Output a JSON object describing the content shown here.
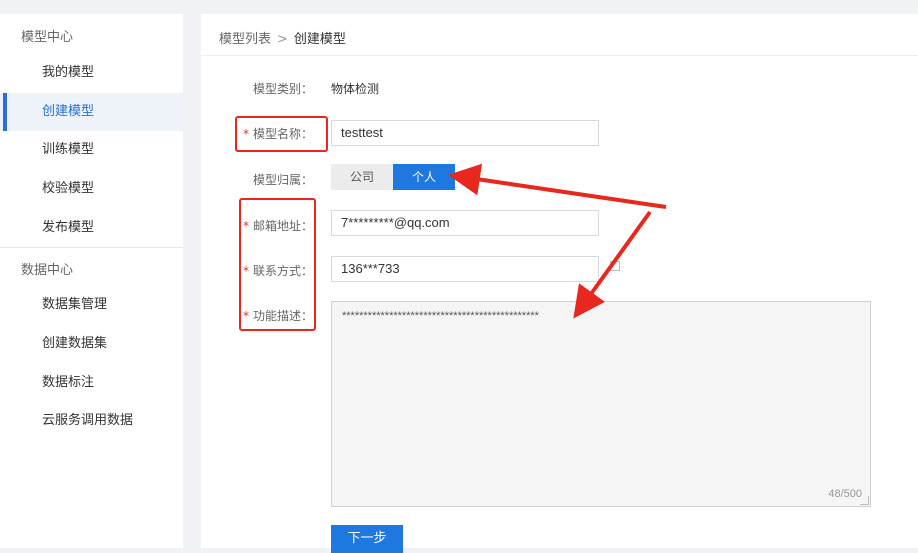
{
  "sidebar": {
    "groups": [
      {
        "title": "模型中心",
        "items": [
          "我的模型",
          "创建模型",
          "训练模型",
          "校验模型",
          "发布模型"
        ]
      },
      {
        "title": "数据中心",
        "items": [
          "数据集管理",
          "创建数据集",
          "数据标注",
          "云服务调用数据"
        ]
      }
    ],
    "active_item": "创建模型"
  },
  "breadcrumb": {
    "parent": "模型列表",
    "separator": ">",
    "current": "创建模型"
  },
  "form": {
    "model_type": {
      "label": "模型类别：",
      "value": "物体检测"
    },
    "model_name": {
      "label": "模型名称：",
      "value": "testtest",
      "required": true
    },
    "ownership": {
      "label": "模型归属：",
      "options": [
        "公司",
        "个人"
      ],
      "selected": "个人"
    },
    "email": {
      "label": "邮箱地址：",
      "value": "7*********@qq.com",
      "required": true
    },
    "contact": {
      "label": "联系方式：",
      "value": "136***733",
      "required": true
    },
    "description": {
      "label": "功能描述：",
      "value": "**********************************************",
      "counter": "48/500",
      "required": true
    },
    "required_mark": "*",
    "next_button": "下一步"
  },
  "colors": {
    "accent": "#1f78e0",
    "annotation_red": "#e8281e"
  }
}
